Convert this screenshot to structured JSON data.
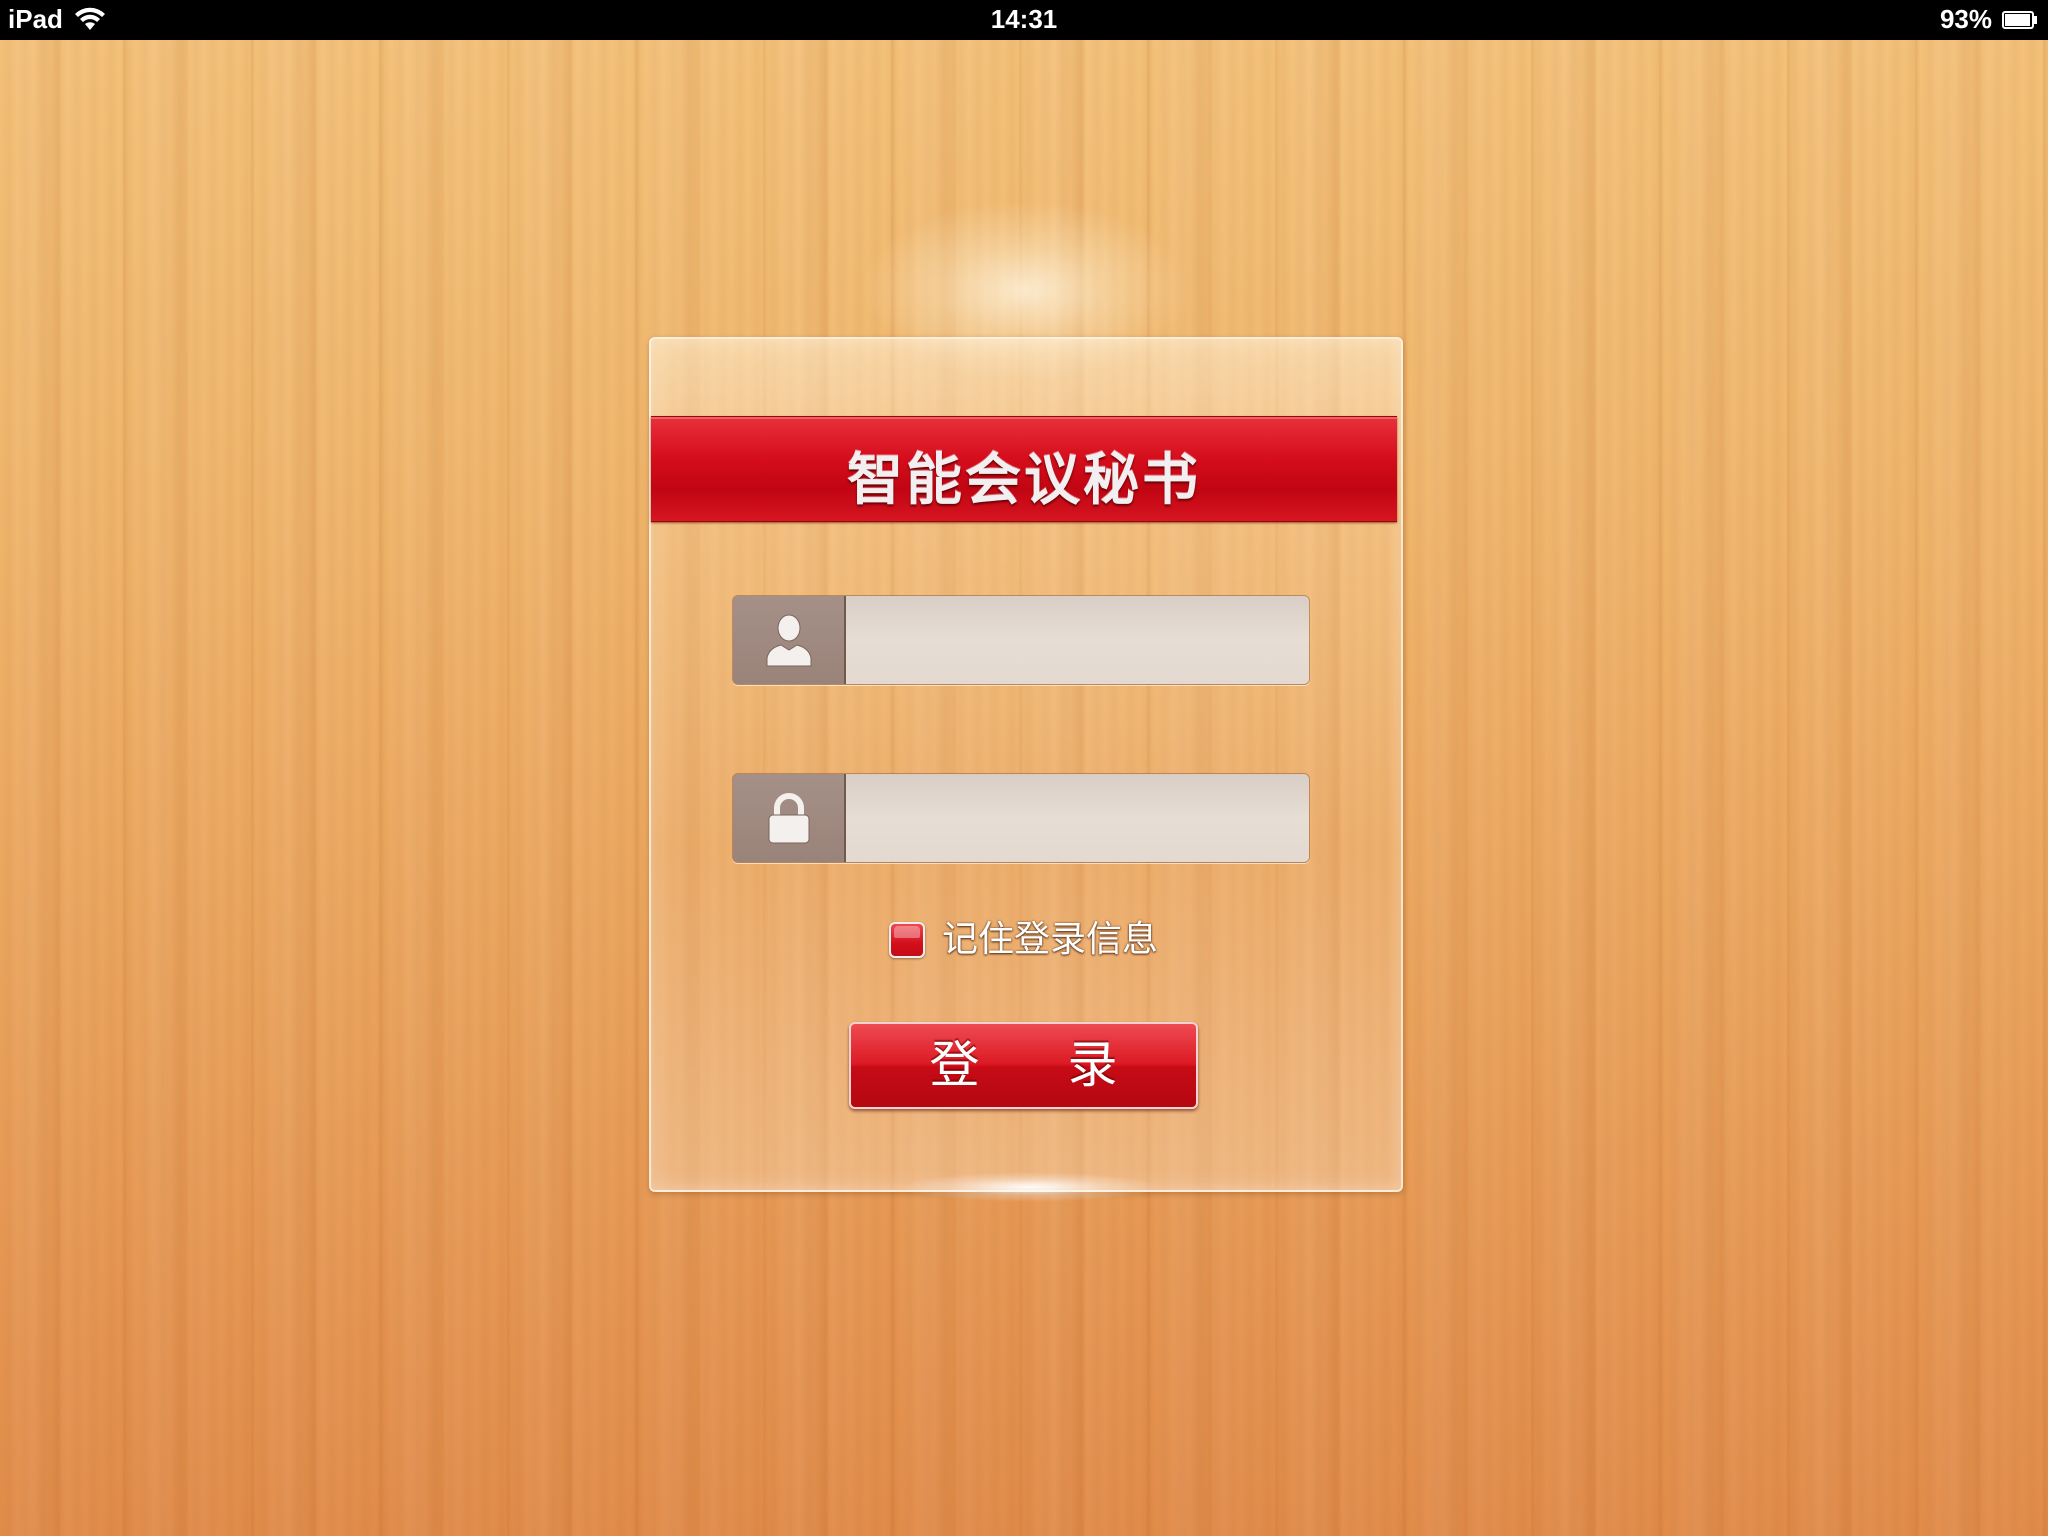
{
  "status_bar": {
    "carrier": "iPad",
    "time": "14:31",
    "battery_percent": "93%",
    "wifi_icon": "wifi-icon",
    "battery_icon": "battery-icon"
  },
  "login": {
    "title": "智能会议秘书",
    "username": {
      "value": "",
      "icon": "user-icon"
    },
    "password": {
      "value": "",
      "icon": "lock-icon"
    },
    "remember_label": "记住登录信息",
    "remember_checked": false,
    "submit_label": "登 录"
  },
  "colors": {
    "accent_red": "#d50d1c",
    "wood": "#f0b46a"
  }
}
